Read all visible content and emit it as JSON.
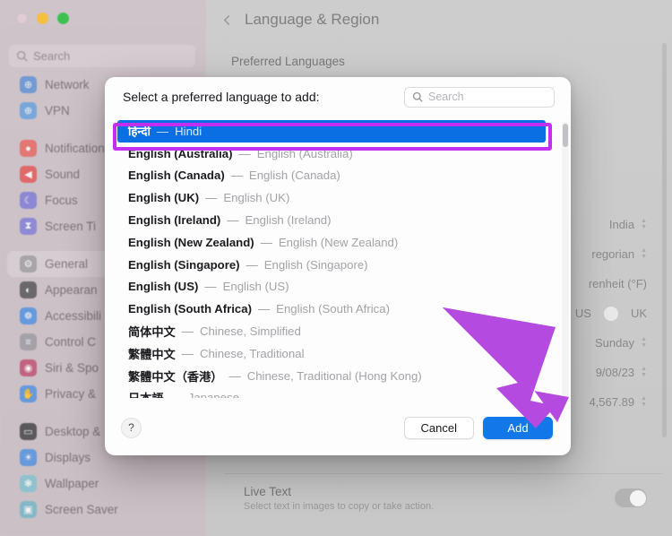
{
  "window": {
    "traffic_lights": [
      "close",
      "minimize",
      "zoom"
    ],
    "sidebar_search_placeholder": "Search"
  },
  "sidebar": {
    "items": [
      {
        "label": "Network",
        "icon": "globe-icon",
        "color": "#5b8fd6"
      },
      {
        "label": "VPN",
        "icon": "vpn-globe-icon",
        "color": "#63a0de"
      },
      {
        "gap": true
      },
      {
        "label": "Notification",
        "icon": "bell-icon",
        "color": "#e8625c"
      },
      {
        "label": "Sound",
        "icon": "speaker-icon",
        "color": "#e4524f"
      },
      {
        "label": "Focus",
        "icon": "moon-icon",
        "color": "#7b78d8"
      },
      {
        "label": "Screen Ti",
        "icon": "hourglass-icon",
        "color": "#7e7bd9"
      },
      {
        "gap": true
      },
      {
        "label": "General",
        "icon": "gear-icon",
        "color": "#9a9aa0",
        "selected": true
      },
      {
        "label": "Appearan",
        "icon": "appearance-icon",
        "color": "#4f4f55"
      },
      {
        "label": "Accessibili",
        "icon": "accessibility-icon",
        "color": "#4a90e2"
      },
      {
        "label": "Control C",
        "icon": "control-center-icon",
        "color": "#9a9aa0"
      },
      {
        "label": "Siri & Spo",
        "icon": "siri-icon",
        "color": "#c0496e"
      },
      {
        "label": "Privacy &",
        "icon": "hand-icon",
        "color": "#4a90e2"
      },
      {
        "gap": true
      },
      {
        "label": "Desktop &",
        "icon": "desktop-icon",
        "color": "#3d3d42"
      },
      {
        "label": "Displays",
        "icon": "display-icon",
        "color": "#4a90e2"
      },
      {
        "label": "Wallpaper",
        "icon": "wallpaper-icon",
        "color": "#7fc3cf"
      },
      {
        "label": "Screen Saver",
        "icon": "screensaver-icon",
        "color": "#6fb6c8"
      }
    ]
  },
  "main": {
    "back_label": "back",
    "title": "Language & Region",
    "section_label": "Preferred Languages",
    "setting_rows": [
      {
        "value": "India",
        "control": "stepper"
      },
      {
        "value": "regorian",
        "control": "stepper"
      },
      {
        "value": "renheit (°F)",
        "control": "none"
      },
      {
        "value": "US",
        "control": "segmented",
        "value2": "UK"
      },
      {
        "value": "Sunday",
        "control": "stepper"
      },
      {
        "value": "9/08/23",
        "control": "stepper"
      },
      {
        "value": "4,567.89",
        "control": "stepper"
      }
    ],
    "live_text": {
      "title": "Live Text",
      "subtitle": "Select text in images to copy or take action.",
      "enabled": true
    }
  },
  "sheet": {
    "prompt": "Select a preferred language to add:",
    "search_placeholder": "Search",
    "help_label": "?",
    "cancel_label": "Cancel",
    "add_label": "Add",
    "languages": [
      {
        "native": "हिन्दी",
        "english": "Hindi",
        "selected": true
      },
      {
        "native": "English (Australia)",
        "english": "English (Australia)"
      },
      {
        "native": "English (Canada)",
        "english": "English (Canada)"
      },
      {
        "native": "English (UK)",
        "english": "English (UK)"
      },
      {
        "native": "English (Ireland)",
        "english": "English (Ireland)"
      },
      {
        "native": "English (New Zealand)",
        "english": "English (New Zealand)"
      },
      {
        "native": "English (Singapore)",
        "english": "English (Singapore)"
      },
      {
        "native": "English (US)",
        "english": "English (US)"
      },
      {
        "native": "English (South Africa)",
        "english": "English (South Africa)"
      },
      {
        "native": "简体中文",
        "english": "Chinese, Simplified"
      },
      {
        "native": "繁體中文",
        "english": "Chinese, Traditional"
      },
      {
        "native": "繁體中文（香港）",
        "english": "Chinese, Traditional (Hong Kong)"
      },
      {
        "native": "日本語",
        "english": "Japanese"
      }
    ],
    "separator": "—"
  },
  "annotations": {
    "highlight_color": "#c22ff0",
    "arrow_color": "#b44ae0",
    "highlight_target": "hindi-row",
    "arrow_target": "add-button"
  },
  "colors": {
    "selection_blue": "#0b6fe4",
    "add_button_blue": "#1277e8"
  }
}
